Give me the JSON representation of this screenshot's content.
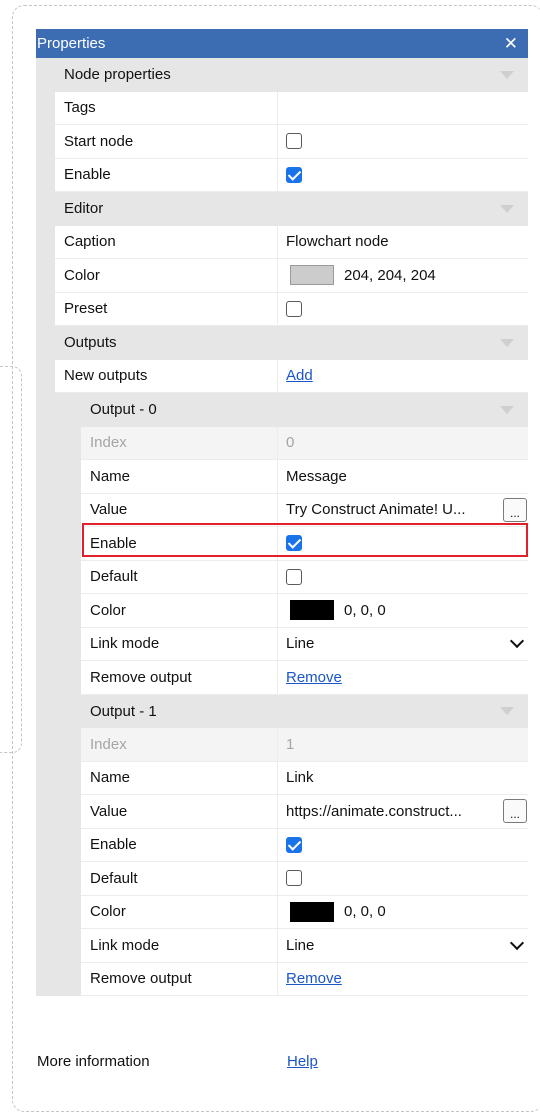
{
  "panel": {
    "title": "Properties",
    "close_label": "✕"
  },
  "node_properties": {
    "label": "Node properties",
    "tags": {
      "name": "Tags",
      "value": ""
    },
    "start_node": {
      "name": "Start node",
      "checked": false
    },
    "enable": {
      "name": "Enable",
      "checked": true
    }
  },
  "editor": {
    "label": "Editor",
    "caption": {
      "name": "Caption",
      "value": "Flowchart node"
    },
    "color": {
      "name": "Color",
      "value": "204, 204, 204",
      "swatch": "#cccccc"
    },
    "preset": {
      "name": "Preset",
      "checked": false
    }
  },
  "outputs": {
    "label": "Outputs",
    "new_outputs": {
      "name": "New outputs",
      "link": "Add"
    },
    "items": [
      {
        "label": "Output - 0",
        "index": {
          "name": "Index",
          "value": "0"
        },
        "name_field": {
          "name": "Name",
          "value": "Message"
        },
        "value_field": {
          "name": "Value",
          "value": "Try Construct Animate! U...",
          "button": "..."
        },
        "enable": {
          "name": "Enable",
          "checked": true
        },
        "default": {
          "name": "Default",
          "checked": false
        },
        "color": {
          "name": "Color",
          "value": "0, 0, 0",
          "swatch": "#000000"
        },
        "link_mode": {
          "name": "Link mode",
          "value": "Line"
        },
        "remove": {
          "name": "Remove output",
          "link": "Remove"
        }
      },
      {
        "label": "Output - 1",
        "index": {
          "name": "Index",
          "value": "1"
        },
        "name_field": {
          "name": "Name",
          "value": "Link"
        },
        "value_field": {
          "name": "Value",
          "value": "https://animate.construct...",
          "button": "..."
        },
        "enable": {
          "name": "Enable",
          "checked": true
        },
        "default": {
          "name": "Default",
          "checked": false
        },
        "color": {
          "name": "Color",
          "value": "0, 0, 0",
          "swatch": "#000000"
        },
        "link_mode": {
          "name": "Link mode",
          "value": "Line"
        },
        "remove": {
          "name": "Remove output",
          "link": "Remove"
        }
      }
    ]
  },
  "more_information": {
    "name": "More information",
    "link": "Help"
  },
  "colors": {
    "titlebar": "#3c6db3",
    "highlight": "#e0202c",
    "checkbox_checked": "#1a73e8",
    "link": "#1a56c9"
  }
}
